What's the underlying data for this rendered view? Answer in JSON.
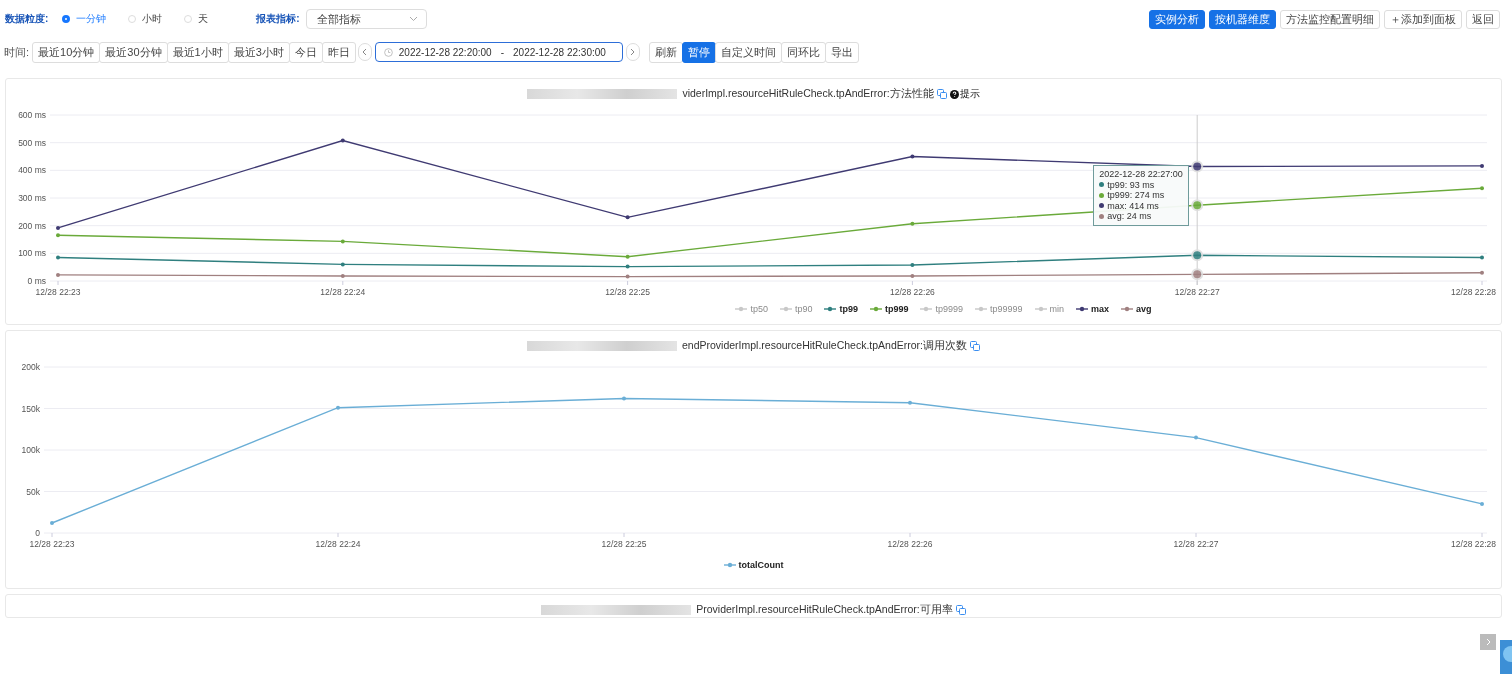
{
  "granularity": {
    "label": "数据粒度:",
    "options": [
      {
        "label": "一分钟",
        "selected": true
      },
      {
        "label": "小时",
        "selected": false
      },
      {
        "label": "天",
        "selected": false
      }
    ]
  },
  "metric": {
    "label": "报表指标:",
    "value": "全部指标"
  },
  "actions": [
    {
      "label": "实例分析",
      "primary": true
    },
    {
      "label": "按机器维度",
      "primary": true
    },
    {
      "label": "方法监控配置明细",
      "primary": false
    },
    {
      "label": "＋添加到面板",
      "primary": false
    },
    {
      "label": "返回",
      "primary": false
    }
  ],
  "time": {
    "label": "时间:",
    "presets": [
      "最近10分钟",
      "最近30分钟",
      "最近1小时",
      "最近3小时",
      "今日",
      "昨日"
    ],
    "date_range": {
      "start": "2022-12-28 22:20:00",
      "separator": "-",
      "end": "2022-12-28 22:30:00"
    }
  },
  "refresh": [
    {
      "label": "刷新",
      "selected": false
    },
    {
      "label": "暂停",
      "selected": true
    }
  ],
  "tools": [
    "自定义时间",
    "同环比",
    "导出"
  ],
  "panels": [
    {
      "title": "viderImpl.resourceHitRuleCheck.tpAndError:方法性能",
      "hint": "提示",
      "chart_data": {
        "type": "line",
        "grid": true,
        "categories": [
          "12/28 22:23",
          "12/28 22:24",
          "12/28 22:25",
          "12/28 22:26",
          "12/28 22:27",
          "12/28 22:28"
        ],
        "ylim": [
          0,
          600
        ],
        "yticks": [
          {
            "value": 0,
            "label": "0 ms"
          },
          {
            "value": 100,
            "label": "100 ms"
          },
          {
            "value": 200,
            "label": "200 ms"
          },
          {
            "value": 300,
            "label": "300 ms"
          },
          {
            "value": 400,
            "label": "400 ms"
          },
          {
            "value": 500,
            "label": "500 ms"
          },
          {
            "value": 600,
            "label": "600 ms"
          }
        ],
        "series": [
          {
            "name": "tp50",
            "color": "#c8c8c8",
            "values": [
              null,
              null,
              null,
              null,
              null,
              null
            ]
          },
          {
            "name": "tp90",
            "color": "#c8c8c8",
            "values": [
              null,
              null,
              null,
              null,
              null,
              null
            ]
          },
          {
            "name": "tp99",
            "color": "#2f7f7f",
            "values": [
              85,
              60,
              52,
              58,
              93,
              85
            ]
          },
          {
            "name": "tp999",
            "color": "#6aaa3a",
            "values": [
              165,
              143,
              88,
              207,
              274,
              335
            ]
          },
          {
            "name": "tp9999",
            "color": "#c8c8c8",
            "values": [
              null,
              null,
              null,
              null,
              null,
              null
            ]
          },
          {
            "name": "tp99999",
            "color": "#c8c8c8",
            "values": [
              null,
              null,
              null,
              null,
              null,
              null
            ]
          },
          {
            "name": "min",
            "color": "#c8c8c8",
            "values": [
              null,
              null,
              null,
              null,
              null,
              null
            ]
          },
          {
            "name": "max",
            "color": "#3f3a72",
            "values": [
              192,
              508,
              230,
              450,
              414,
              416
            ]
          },
          {
            "name": "avg",
            "color": "#a08080",
            "values": [
              22,
              18,
              16,
              18,
              24,
              30
            ]
          }
        ],
        "ref_lines": [
          {
            "axis": "x",
            "value": "12/28 22:27",
            "color": "#cccccc"
          }
        ]
      },
      "tooltip": {
        "title": "2022-12-28 22:27:00",
        "rows": [
          {
            "text": "tp99: 93 ms",
            "color": "#2f7f7f"
          },
          {
            "text": "tp999: 274 ms",
            "color": "#6aaa3a"
          },
          {
            "text": "max: 414 ms",
            "color": "#3f3a72"
          },
          {
            "text": "avg: 24 ms",
            "color": "#a08080"
          }
        ]
      }
    },
    {
      "title": "endProviderImpl.resourceHitRuleCheck.tpAndError:调用次数",
      "chart_data": {
        "type": "line",
        "grid": true,
        "categories": [
          "12/28 22:23",
          "12/28 22:24",
          "12/28 22:25",
          "12/28 22:26",
          "12/28 22:27",
          "12/28 22:28"
        ],
        "ylim": [
          0,
          200000
        ],
        "yticks": [
          {
            "value": 0,
            "label": "0"
          },
          {
            "value": 50000,
            "label": "50k"
          },
          {
            "value": 100000,
            "label": "100k"
          },
          {
            "value": 150000,
            "label": "150k"
          },
          {
            "value": 200000,
            "label": "200k"
          }
        ],
        "series": [
          {
            "name": "totalCount",
            "color": "#6aaed6",
            "values": [
              12000,
              151000,
              162000,
              157000,
              115000,
              35000
            ]
          }
        ]
      }
    },
    {
      "title": "ProviderImpl.resourceHitRuleCheck.tpAndError:可用率"
    }
  ]
}
